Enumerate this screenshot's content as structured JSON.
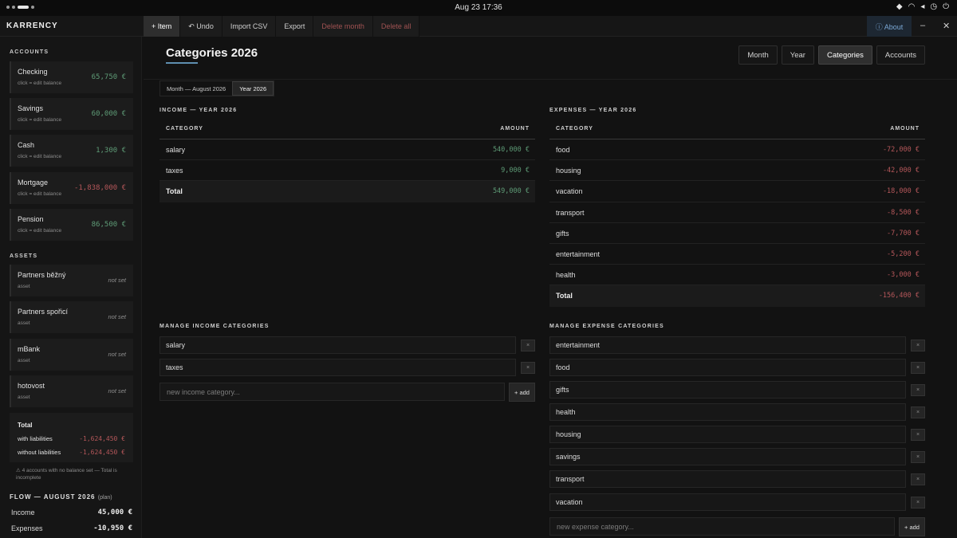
{
  "system": {
    "clock": "Aug 23  17:36"
  },
  "app": {
    "brand": "KARRENCY"
  },
  "toolbar": {
    "item": "+ Item",
    "undo": "↶ Undo",
    "import": "Import CSV",
    "export": "Export",
    "delete_month": "Delete month",
    "delete_all": "Delete all",
    "about": "ⓘ About"
  },
  "sidebar": {
    "accounts_heading": "ACCOUNTS",
    "accounts": [
      {
        "name": "Checking",
        "sub": "click = edit balance",
        "amount": "65,750 €",
        "sign": "pos"
      },
      {
        "name": "Savings",
        "sub": "click = edit balance",
        "amount": "60,000 €",
        "sign": "pos"
      },
      {
        "name": "Cash",
        "sub": "click = edit balance",
        "amount": "1,300 €",
        "sign": "pos"
      },
      {
        "name": "Mortgage",
        "sub": "click = edit balance",
        "amount": "-1,838,000 €",
        "sign": "neg"
      },
      {
        "name": "Pension",
        "sub": "click = edit balance",
        "amount": "86,500 €",
        "sign": "pos"
      }
    ],
    "assets_heading": "ASSETS",
    "assets": [
      {
        "name": "Partners běžný",
        "sub": "asset",
        "status": "not set"
      },
      {
        "name": "Partners spořicí",
        "sub": "asset",
        "status": "not set"
      },
      {
        "name": "mBank",
        "sub": "asset",
        "status": "not set"
      },
      {
        "name": "hotovost",
        "sub": "asset",
        "status": "not set"
      }
    ],
    "total": {
      "title": "Total",
      "with_label": "with liabilities",
      "with_value": "-1,624,450 €",
      "without_label": "without liabilities",
      "without_value": "-1,624,450 €"
    },
    "warning": "⚠ 4 accounts with no balance set — Total is incomplete",
    "flow": {
      "heading": "FLOW — AUGUST 2026",
      "plan": "(plan)",
      "income_label": "Income",
      "income_value": "45,000 €",
      "expenses_label": "Expenses",
      "expenses_value": "-10,950 €"
    }
  },
  "main": {
    "title": "Categories 2026",
    "views": [
      "Month",
      "Year",
      "Categories",
      "Accounts"
    ],
    "active_view": "Categories",
    "period": {
      "month": "Month — August 2026",
      "year": "Year 2026"
    },
    "income": {
      "heading": "INCOME — YEAR 2026",
      "col_category": "CATEGORY",
      "col_amount": "AMOUNT",
      "rows": [
        {
          "category": "salary",
          "amount": "540,000 €"
        },
        {
          "category": "taxes",
          "amount": "9,000 €"
        }
      ],
      "total_label": "Total",
      "total_amount": "549,000 €"
    },
    "expenses": {
      "heading": "EXPENSES — YEAR 2026",
      "col_category": "CATEGORY",
      "col_amount": "AMOUNT",
      "rows": [
        {
          "category": "food",
          "amount": "-72,000 €"
        },
        {
          "category": "housing",
          "amount": "-42,000 €"
        },
        {
          "category": "vacation",
          "amount": "-18,000 €"
        },
        {
          "category": "transport",
          "amount": "-8,500 €"
        },
        {
          "category": "gifts",
          "amount": "-7,700 €"
        },
        {
          "category": "entertainment",
          "amount": "-5,200 €"
        },
        {
          "category": "health",
          "amount": "-3,000 €"
        }
      ],
      "total_label": "Total",
      "total_amount": "-156,400 €"
    },
    "manage_income": {
      "heading": "MANAGE INCOME CATEGORIES",
      "items": [
        "salary",
        "taxes"
      ],
      "remove": "×",
      "placeholder": "new income category...",
      "add": "+ add"
    },
    "manage_expense": {
      "heading": "MANAGE EXPENSE CATEGORIES",
      "items": [
        "entertainment",
        "food",
        "gifts",
        "health",
        "housing",
        "savings",
        "transport",
        "vacation"
      ],
      "remove": "×",
      "placeholder": "new expense category...",
      "add": "+ add"
    }
  },
  "colors": {
    "positive": "#5e9b76",
    "negative": "#b5575a",
    "accent": "#5e8fb0"
  }
}
